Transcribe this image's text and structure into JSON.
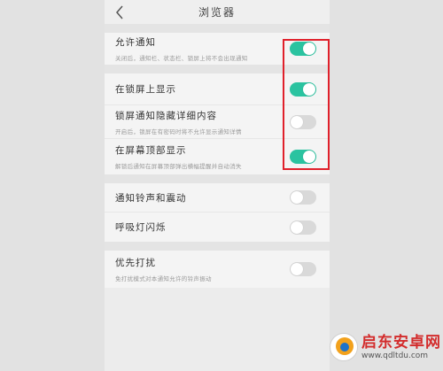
{
  "header": {
    "title": "浏览器"
  },
  "groups": [
    [
      {
        "label": "允许通知",
        "sub": "关闭后，通知栏、状态栏、锁屏上将不会出现通知",
        "on": true
      }
    ],
    [
      {
        "label": "在锁屏上显示",
        "sub": "",
        "on": true
      },
      {
        "label": "锁屏通知隐藏详细内容",
        "sub": "开启后，锁屏在有密码时将不允许显示通知详情",
        "on": false
      },
      {
        "label": "在屏幕顶部显示",
        "sub": "解锁后通知在屏幕顶部弹出横幅提醒并自动消失",
        "on": true
      }
    ],
    [
      {
        "label": "通知铃声和震动",
        "sub": "",
        "on": false
      },
      {
        "label": "呼吸灯闪烁",
        "sub": "",
        "on": false
      }
    ],
    [
      {
        "label": "优先打扰",
        "sub": "免打扰模式对本通知允许的铃声振动",
        "on": false
      }
    ]
  ],
  "colors": {
    "toggle_on": "#2bc3a0",
    "toggle_off": "#d9d9d9",
    "highlight": "#e0202b"
  },
  "watermark": {
    "name": "启东安卓网",
    "url": "www.qdltdu.com"
  }
}
